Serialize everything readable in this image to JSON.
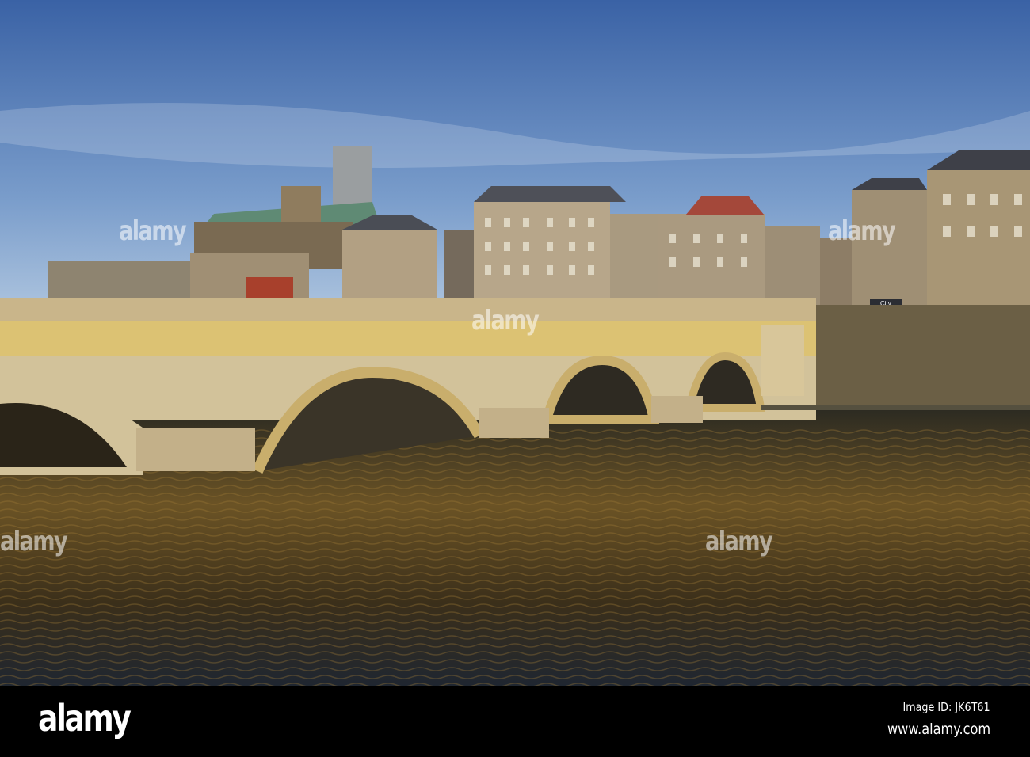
{
  "footer": {
    "logo": "alamy",
    "image_id": "Image ID: JK6T61",
    "website": "www.alamy.com"
  },
  "watermark": "alamy",
  "shop_sign": "City",
  "colors": {
    "sky_top": "#3d66a8",
    "sky_bottom": "#a9c3df",
    "bridge": "#d8c58e",
    "water": "#3a2e1c"
  }
}
